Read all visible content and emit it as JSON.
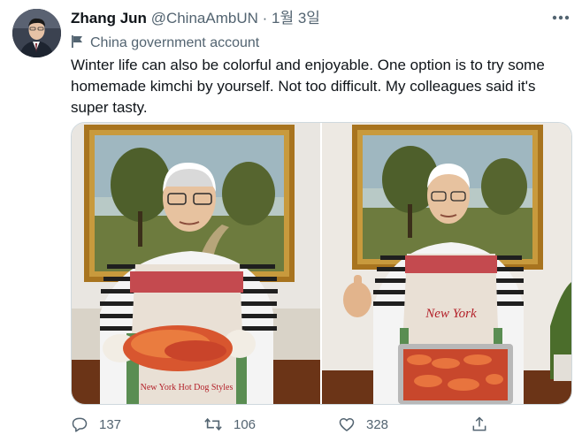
{
  "author": {
    "name": "Zhang Jun",
    "handle": "@ChinaAmbUN",
    "separator": "·",
    "date": "1월 3일"
  },
  "account_label": "China government account",
  "tweet_text": "Winter life can also be colorful and enjoyable. One option is to try some homemade kimchi by yourself. Not too difficult. My colleagues said it's super tasty.",
  "apron_text_left": "New York Hot Dog Styles",
  "apron_text_right": "New York",
  "actions": {
    "replies": "137",
    "retweets": "106",
    "likes": "328"
  },
  "colors": {
    "text": "#0f1419",
    "secondary": "#536471",
    "border": "#cfd9de"
  },
  "icons": [
    "more-icon",
    "flag-icon",
    "reply-icon",
    "retweet-icon",
    "like-icon",
    "share-icon"
  ]
}
